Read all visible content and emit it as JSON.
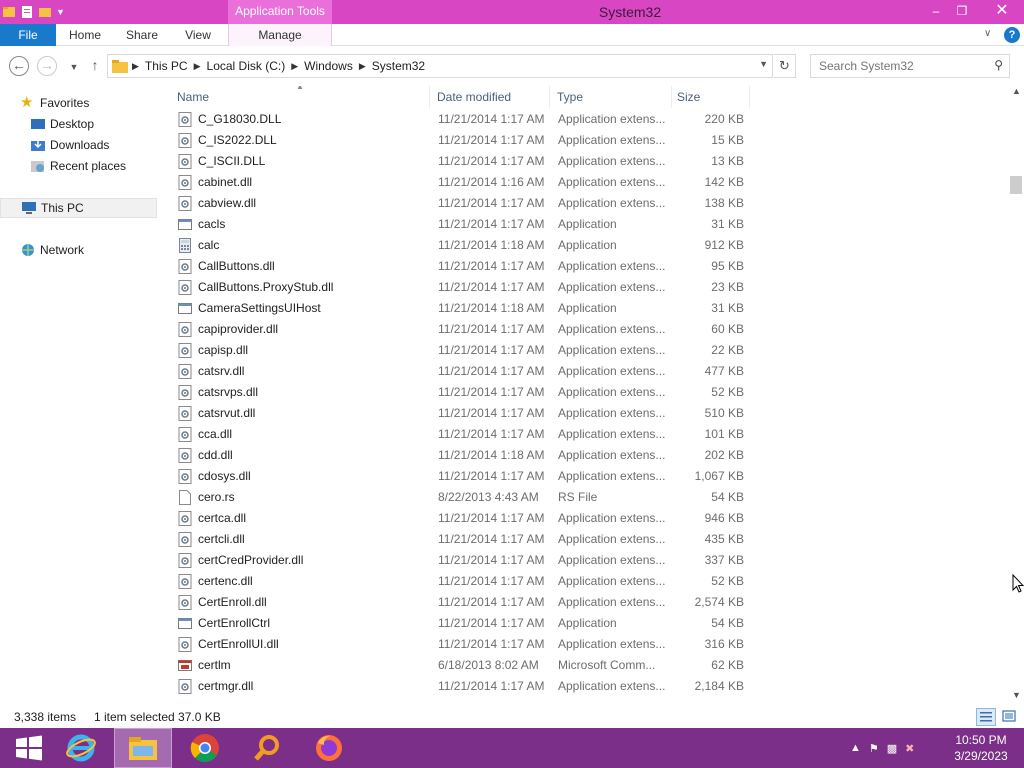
{
  "window": {
    "title": "System32",
    "context_tab_group": "Application Tools",
    "minimize": "–",
    "restore": "❐",
    "close": "✕"
  },
  "ribbon": {
    "tabs": [
      "File",
      "Home",
      "Share",
      "View",
      "Manage"
    ],
    "collapse": "∨",
    "help": "?"
  },
  "address": {
    "crumbs": [
      "This PC",
      "Local Disk (C:)",
      "Windows",
      "System32"
    ],
    "sep": "▶",
    "search_placeholder": "Search System32"
  },
  "nav": {
    "favorites": "Favorites",
    "desktop": "Desktop",
    "downloads": "Downloads",
    "recent": "Recent places",
    "thispc": "This PC",
    "network": "Network"
  },
  "columns": {
    "name": "Name",
    "date": "Date modified",
    "type": "Type",
    "size": "Size"
  },
  "files": [
    {
      "name": "C_G18030.DLL",
      "date": "11/21/2014 1:17 AM",
      "type": "Application extens...",
      "size": "220 KB",
      "icon": "dll"
    },
    {
      "name": "C_IS2022.DLL",
      "date": "11/21/2014 1:17 AM",
      "type": "Application extens...",
      "size": "15 KB",
      "icon": "dll"
    },
    {
      "name": "C_ISCII.DLL",
      "date": "11/21/2014 1:17 AM",
      "type": "Application extens...",
      "size": "13 KB",
      "icon": "dll"
    },
    {
      "name": "cabinet.dll",
      "date": "11/21/2014 1:16 AM",
      "type": "Application extens...",
      "size": "142 KB",
      "icon": "dll"
    },
    {
      "name": "cabview.dll",
      "date": "11/21/2014 1:17 AM",
      "type": "Application extens...",
      "size": "138 KB",
      "icon": "dll"
    },
    {
      "name": "cacls",
      "date": "11/21/2014 1:17 AM",
      "type": "Application",
      "size": "31 KB",
      "icon": "exe"
    },
    {
      "name": "calc",
      "date": "11/21/2014 1:18 AM",
      "type": "Application",
      "size": "912 KB",
      "icon": "calc"
    },
    {
      "name": "CallButtons.dll",
      "date": "11/21/2014 1:17 AM",
      "type": "Application extens...",
      "size": "95 KB",
      "icon": "dll"
    },
    {
      "name": "CallButtons.ProxyStub.dll",
      "date": "11/21/2014 1:17 AM",
      "type": "Application extens...",
      "size": "23 KB",
      "icon": "dll"
    },
    {
      "name": "CameraSettingsUIHost",
      "date": "11/21/2014 1:18 AM",
      "type": "Application",
      "size": "31 KB",
      "icon": "exe"
    },
    {
      "name": "capiprovider.dll",
      "date": "11/21/2014 1:17 AM",
      "type": "Application extens...",
      "size": "60 KB",
      "icon": "dll"
    },
    {
      "name": "capisp.dll",
      "date": "11/21/2014 1:17 AM",
      "type": "Application extens...",
      "size": "22 KB",
      "icon": "dll"
    },
    {
      "name": "catsrv.dll",
      "date": "11/21/2014 1:17 AM",
      "type": "Application extens...",
      "size": "477 KB",
      "icon": "dll"
    },
    {
      "name": "catsrvps.dll",
      "date": "11/21/2014 1:17 AM",
      "type": "Application extens...",
      "size": "52 KB",
      "icon": "dll"
    },
    {
      "name": "catsrvut.dll",
      "date": "11/21/2014 1:17 AM",
      "type": "Application extens...",
      "size": "510 KB",
      "icon": "dll"
    },
    {
      "name": "cca.dll",
      "date": "11/21/2014 1:17 AM",
      "type": "Application extens...",
      "size": "101 KB",
      "icon": "dll"
    },
    {
      "name": "cdd.dll",
      "date": "11/21/2014 1:18 AM",
      "type": "Application extens...",
      "size": "202 KB",
      "icon": "dll"
    },
    {
      "name": "cdosys.dll",
      "date": "11/21/2014 1:17 AM",
      "type": "Application extens...",
      "size": "1,067 KB",
      "icon": "dll"
    },
    {
      "name": "cero.rs",
      "date": "8/22/2013 4:43 AM",
      "type": "RS File",
      "size": "54 KB",
      "icon": "file"
    },
    {
      "name": "certca.dll",
      "date": "11/21/2014 1:17 AM",
      "type": "Application extens...",
      "size": "946 KB",
      "icon": "dll"
    },
    {
      "name": "certcli.dll",
      "date": "11/21/2014 1:17 AM",
      "type": "Application extens...",
      "size": "435 KB",
      "icon": "dll"
    },
    {
      "name": "certCredProvider.dll",
      "date": "11/21/2014 1:17 AM",
      "type": "Application extens...",
      "size": "337 KB",
      "icon": "dll"
    },
    {
      "name": "certenc.dll",
      "date": "11/21/2014 1:17 AM",
      "type": "Application extens...",
      "size": "52 KB",
      "icon": "dll"
    },
    {
      "name": "CertEnroll.dll",
      "date": "11/21/2014 1:17 AM",
      "type": "Application extens...",
      "size": "2,574 KB",
      "icon": "dll"
    },
    {
      "name": "CertEnrollCtrl",
      "date": "11/21/2014 1:17 AM",
      "type": "Application",
      "size": "54 KB",
      "icon": "exe"
    },
    {
      "name": "CertEnrollUI.dll",
      "date": "11/21/2014 1:17 AM",
      "type": "Application extens...",
      "size": "316 KB",
      "icon": "dll"
    },
    {
      "name": "certlm",
      "date": "6/18/2013 8:02 AM",
      "type": "Microsoft Comm...",
      "size": "62 KB",
      "icon": "msc"
    },
    {
      "name": "certmgr.dll",
      "date": "11/21/2014 1:17 AM",
      "type": "Application extens...",
      "size": "2,184 KB",
      "icon": "dll"
    }
  ],
  "status": {
    "count": "3,338 items",
    "selected": "1 item selected  37.0 KB"
  },
  "clock": {
    "time": "10:50 PM",
    "date": "3/29/2023"
  }
}
